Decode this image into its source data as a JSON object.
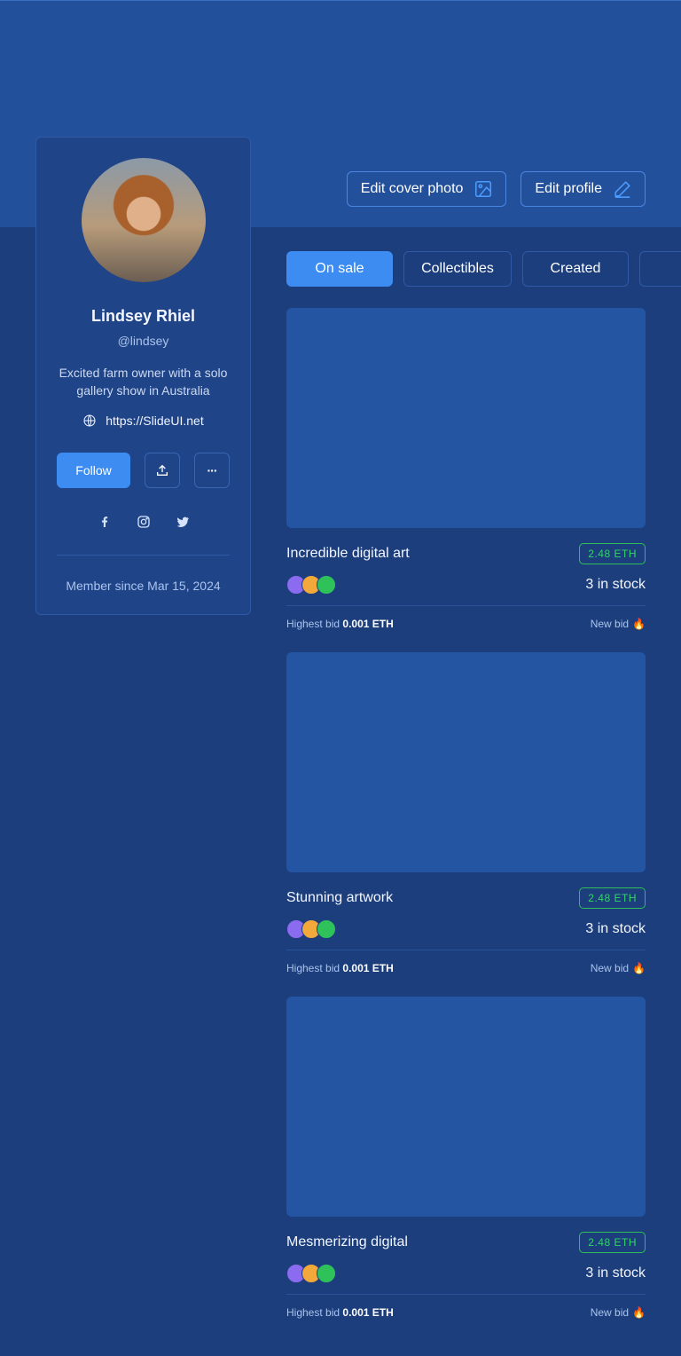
{
  "header": {
    "edit_cover_label": "Edit cover photo",
    "edit_profile_label": "Edit profile"
  },
  "profile": {
    "name": "Lindsey Rhiel",
    "handle": "@lindsey",
    "bio": "Excited farm owner with a solo gallery show in Australia",
    "website": "https://SlideUI.net",
    "follow_label": "Follow",
    "more_label": "···",
    "member_since": "Member since Mar 15, 2024"
  },
  "tabs": [
    {
      "label": "On sale",
      "active": true
    },
    {
      "label": "Collectibles",
      "active": false
    },
    {
      "label": "Created",
      "active": false
    },
    {
      "label": "",
      "active": false
    }
  ],
  "items": [
    {
      "title": "Incredible digital art",
      "price": "2.48 ETH",
      "stock": "3 in stock",
      "bid_label": "Highest bid",
      "bid_value": "0.001 ETH",
      "new_bid_label": "New bid",
      "new_bid_icon": "🔥"
    },
    {
      "title": "Stunning artwork",
      "price": "2.48 ETH",
      "stock": "3 in stock",
      "bid_label": "Highest bid",
      "bid_value": "0.001 ETH",
      "new_bid_label": "New bid",
      "new_bid_icon": "🔥"
    },
    {
      "title": "Mesmerizing digital",
      "price": "2.48 ETH",
      "stock": "3 in stock",
      "bid_label": "Highest bid",
      "bid_value": "0.001 ETH",
      "new_bid_label": "New bid",
      "new_bid_icon": "🔥"
    }
  ],
  "colors": {
    "background": "#1c3e7c",
    "cover": "#23509b",
    "accent": "#3d8cf2",
    "price_green": "#34d36a",
    "owner_avatar_colors": [
      "#8b6cf0",
      "#f2a83a",
      "#2fc25b"
    ]
  }
}
